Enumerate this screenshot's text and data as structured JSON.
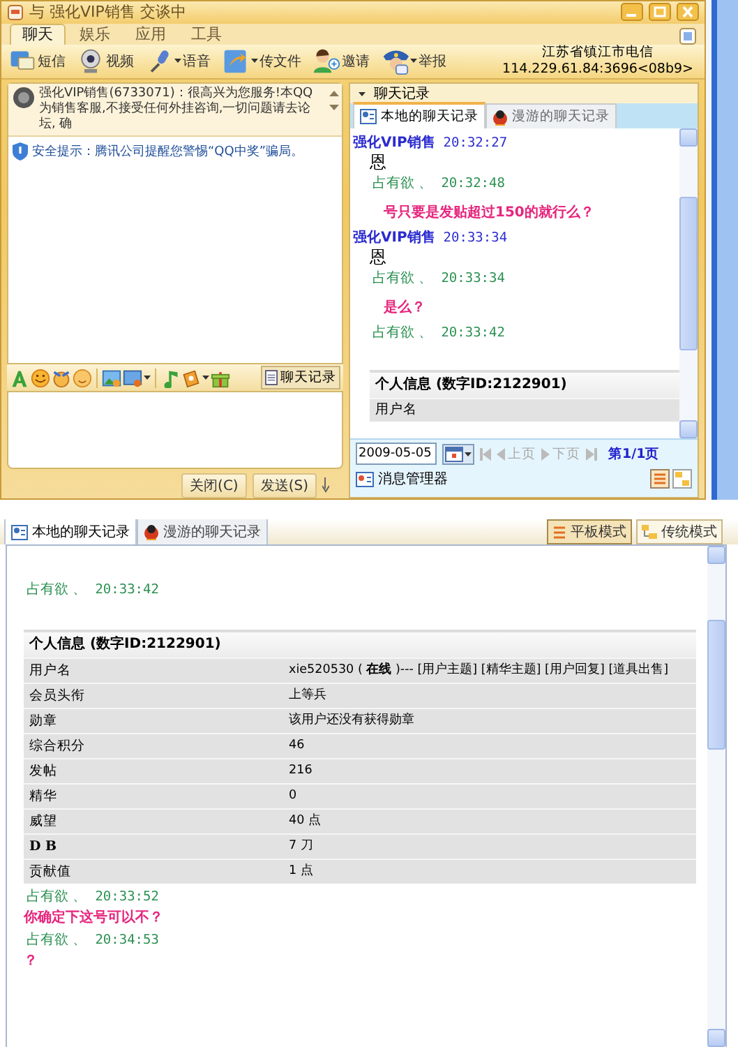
{
  "chat_window": {
    "title": "与 强化VIP销售 交谈中",
    "menu_tabs": [
      {
        "label": "聊天",
        "selected": true
      },
      {
        "label": "娱乐",
        "selected": false
      },
      {
        "label": "应用",
        "selected": false
      },
      {
        "label": "工具",
        "selected": false
      }
    ],
    "toolbar": [
      {
        "label": "短信",
        "dropdown": false
      },
      {
        "label": "视频",
        "dropdown": false
      },
      {
        "label": "语音",
        "dropdown": true
      },
      {
        "label": "传文件",
        "dropdown": true
      },
      {
        "label": "邀请",
        "dropdown": false
      },
      {
        "label": "举报",
        "dropdown": true
      }
    ],
    "location": {
      "region": "江苏省镇江市电信",
      "address": "114.229.61.84:3696<08b9>"
    },
    "notice": "强化VIP销售(6733071)：很高兴为您服务!本QQ为销售客服,不接受任何外挂咨询,一切问题请去论坛, 确",
    "security_tip": "安全提示：腾讯公司提醒您警惕“QQ中奖”骗局。",
    "history_button": "聊天记录",
    "buttons": [
      "关闭(C)",
      "发送(S)"
    ],
    "history": {
      "title": "聊天记录",
      "tabs": [
        {
          "label": "本地的聊天记录",
          "selected": true
        },
        {
          "label": "漫游的聊天记录",
          "selected": false
        }
      ],
      "entries": [
        {
          "kind": "message",
          "outgoing": false,
          "sender": "强化VIP销售",
          "time": "20:32:27",
          "text": "恩"
        },
        {
          "kind": "message",
          "outgoing": true,
          "sender": "占有欲 、",
          "time": "20:32:48",
          "text": "号只要是发贴超过150的就行么？"
        },
        {
          "kind": "message",
          "outgoing": false,
          "sender": "强化VIP销售",
          "time": "20:33:34",
          "text": "恩"
        },
        {
          "kind": "message",
          "outgoing": true,
          "sender": "占有欲 、",
          "time": "20:33:34",
          "text": "是么？"
        },
        {
          "kind": "message",
          "outgoing": true,
          "sender": "占有欲 、",
          "time": "20:33:42"
        },
        {
          "kind": "profile",
          "title": "个人信息 (数字ID:2122901)",
          "rows": [
            {
              "label": "用户名",
              "bold": false
            }
          ]
        }
      ],
      "date": "2009-05-05",
      "nav": [
        {
          "label": "上页",
          "disabled": true
        },
        {
          "label": "下页",
          "disabled": true
        }
      ],
      "page": "第1/1页",
      "manager": "消息管理器"
    }
  },
  "history_window": {
    "tabs": [
      {
        "label": "本地的聊天记录",
        "selected": true
      },
      {
        "label": "漫游的聊天记录",
        "selected": false
      }
    ],
    "view_modes": [
      {
        "label": "平板模式",
        "selected": true
      },
      {
        "label": "传统模式",
        "selected": false
      }
    ],
    "entries": [
      {
        "kind": "message",
        "outgoing": true,
        "sender": "占有欲 、",
        "time": "20:33:42"
      },
      {
        "kind": "profile",
        "title": "个人信息 (数字ID:2122901)",
        "rows": [
          {
            "label": "用户名",
            "bold": false,
            "value": "xie520530 ( **在线** )--- [用户主题] [精华主题] [用户回复] [道具出售]"
          },
          {
            "label": "会员头衔",
            "bold": false,
            "value": "上等兵"
          },
          {
            "label": "勋章",
            "bold": false,
            "value": "该用户还没有获得勋章"
          },
          {
            "label": "综合积分",
            "bold": false,
            "value": "46"
          },
          {
            "label": "发帖",
            "bold": false,
            "value": "216"
          },
          {
            "label": "精华",
            "bold": false,
            "value": "0"
          },
          {
            "label": "威望",
            "bold": false,
            "value": "40 点"
          },
          {
            "label": "D B",
            "bold": true,
            "value": "7 刀"
          },
          {
            "label": "贡献值",
            "bold": false,
            "value": "1 点"
          }
        ]
      },
      {
        "kind": "message",
        "outgoing": true,
        "sender": "占有欲 、",
        "time": "20:33:52",
        "text": "你确定下这号可以不？"
      },
      {
        "kind": "message",
        "outgoing": true,
        "sender": "占有欲 、",
        "time": "20:34:53",
        "text": "？"
      }
    ]
  }
}
